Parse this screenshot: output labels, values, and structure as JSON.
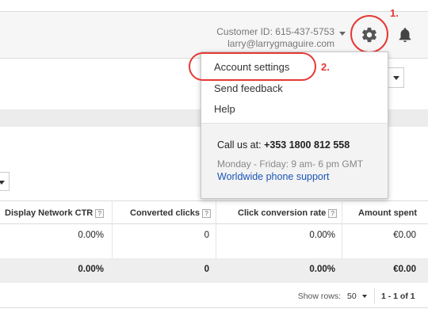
{
  "header": {
    "customer_id": "Customer ID: 615-437-5753",
    "email": "larry@larrygmaguire.com"
  },
  "annotations": {
    "step1": "1.",
    "step2": "2.",
    "color": "#e53935"
  },
  "menu": {
    "items": [
      "Account settings",
      "Send feedback",
      "Help"
    ],
    "call_label": "Call us at:",
    "call_number": "+353 1800 812 558",
    "hours": "Monday - Friday: 9 am- 6 pm GMT",
    "support_link": "Worldwide phone support"
  },
  "table": {
    "headers": [
      "Display Network CTR",
      "Converted clicks",
      "Click conversion rate",
      "Amount spent"
    ],
    "help_glyph": "?",
    "row": [
      "0.00%",
      "0",
      "0.00%",
      "€0.00"
    ],
    "total": [
      "0.00%",
      "0",
      "0.00%",
      "€0.00"
    ]
  },
  "pagination": {
    "show_rows_label": "Show rows:",
    "rows_value": "50",
    "range": "1 - 1 of 1"
  },
  "icons": {
    "gear": "gear-icon",
    "bell": "bell-icon"
  },
  "colors": {
    "link": "#1a56b8",
    "header_bg": "#f6f6f6"
  }
}
